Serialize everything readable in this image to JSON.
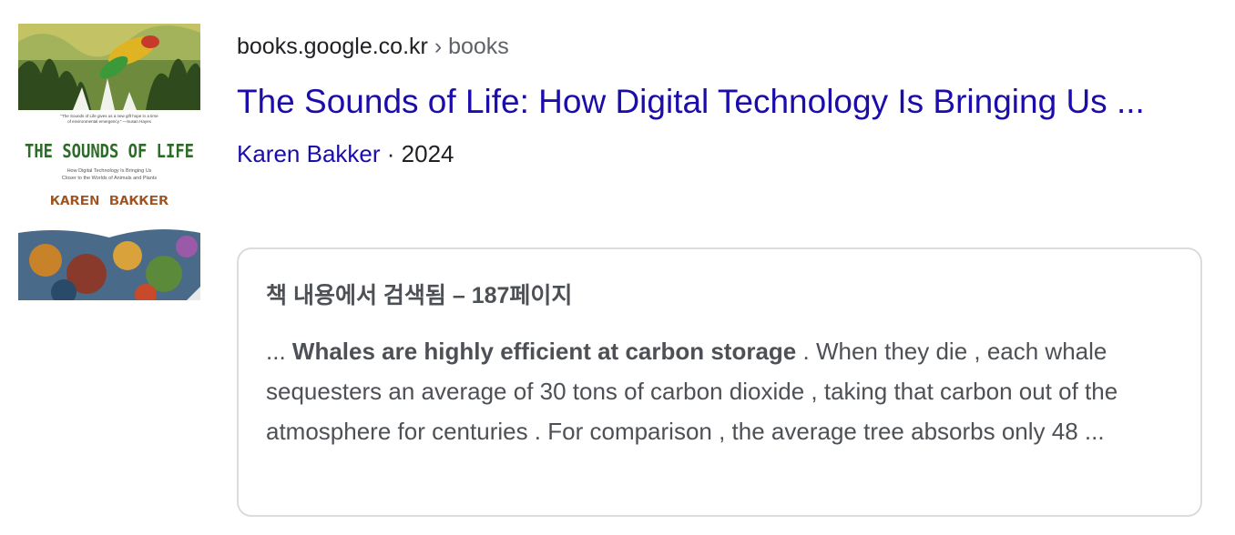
{
  "breadcrumb": {
    "domain": "books.google.co.kr",
    "separator": "›",
    "path": "books"
  },
  "result": {
    "title": "The Sounds of Life: How Digital Technology Is Bringing Us ...",
    "author": "Karen Bakker",
    "separator": "·",
    "year": "2024"
  },
  "cover": {
    "quote_line_1": "\"The Sounds of Life gives us a new gift hope in a time",
    "quote_line_2": "of environmental emergency.\" —Susan Hayes",
    "title": "THE SOUNDS OF LIFE",
    "subtitle_line_1": "How Digital Technology Is Bringing Us",
    "subtitle_line_2": "Closer to the Worlds of Animals and Plants",
    "author": "KAREN BAKKER"
  },
  "snippet": {
    "header": "책 내용에서 검색됨 – 187페이지",
    "prefix": "... ",
    "highlight": "Whales are highly efficient at carbon storage",
    "text": " . When they die , each whale sequesters an average of 30 tons of carbon dioxide , taking that carbon out of the atmosphere for centuries . For comparison , the average tree absorbs only 48 ..."
  },
  "colors": {
    "link": "#1a0dab",
    "text": "#202124",
    "muted": "#5f6368",
    "snippet_text": "#4d5156",
    "card_border": "#dadce0",
    "cover_title": "#2e6b2a",
    "cover_author": "#a0521e"
  }
}
